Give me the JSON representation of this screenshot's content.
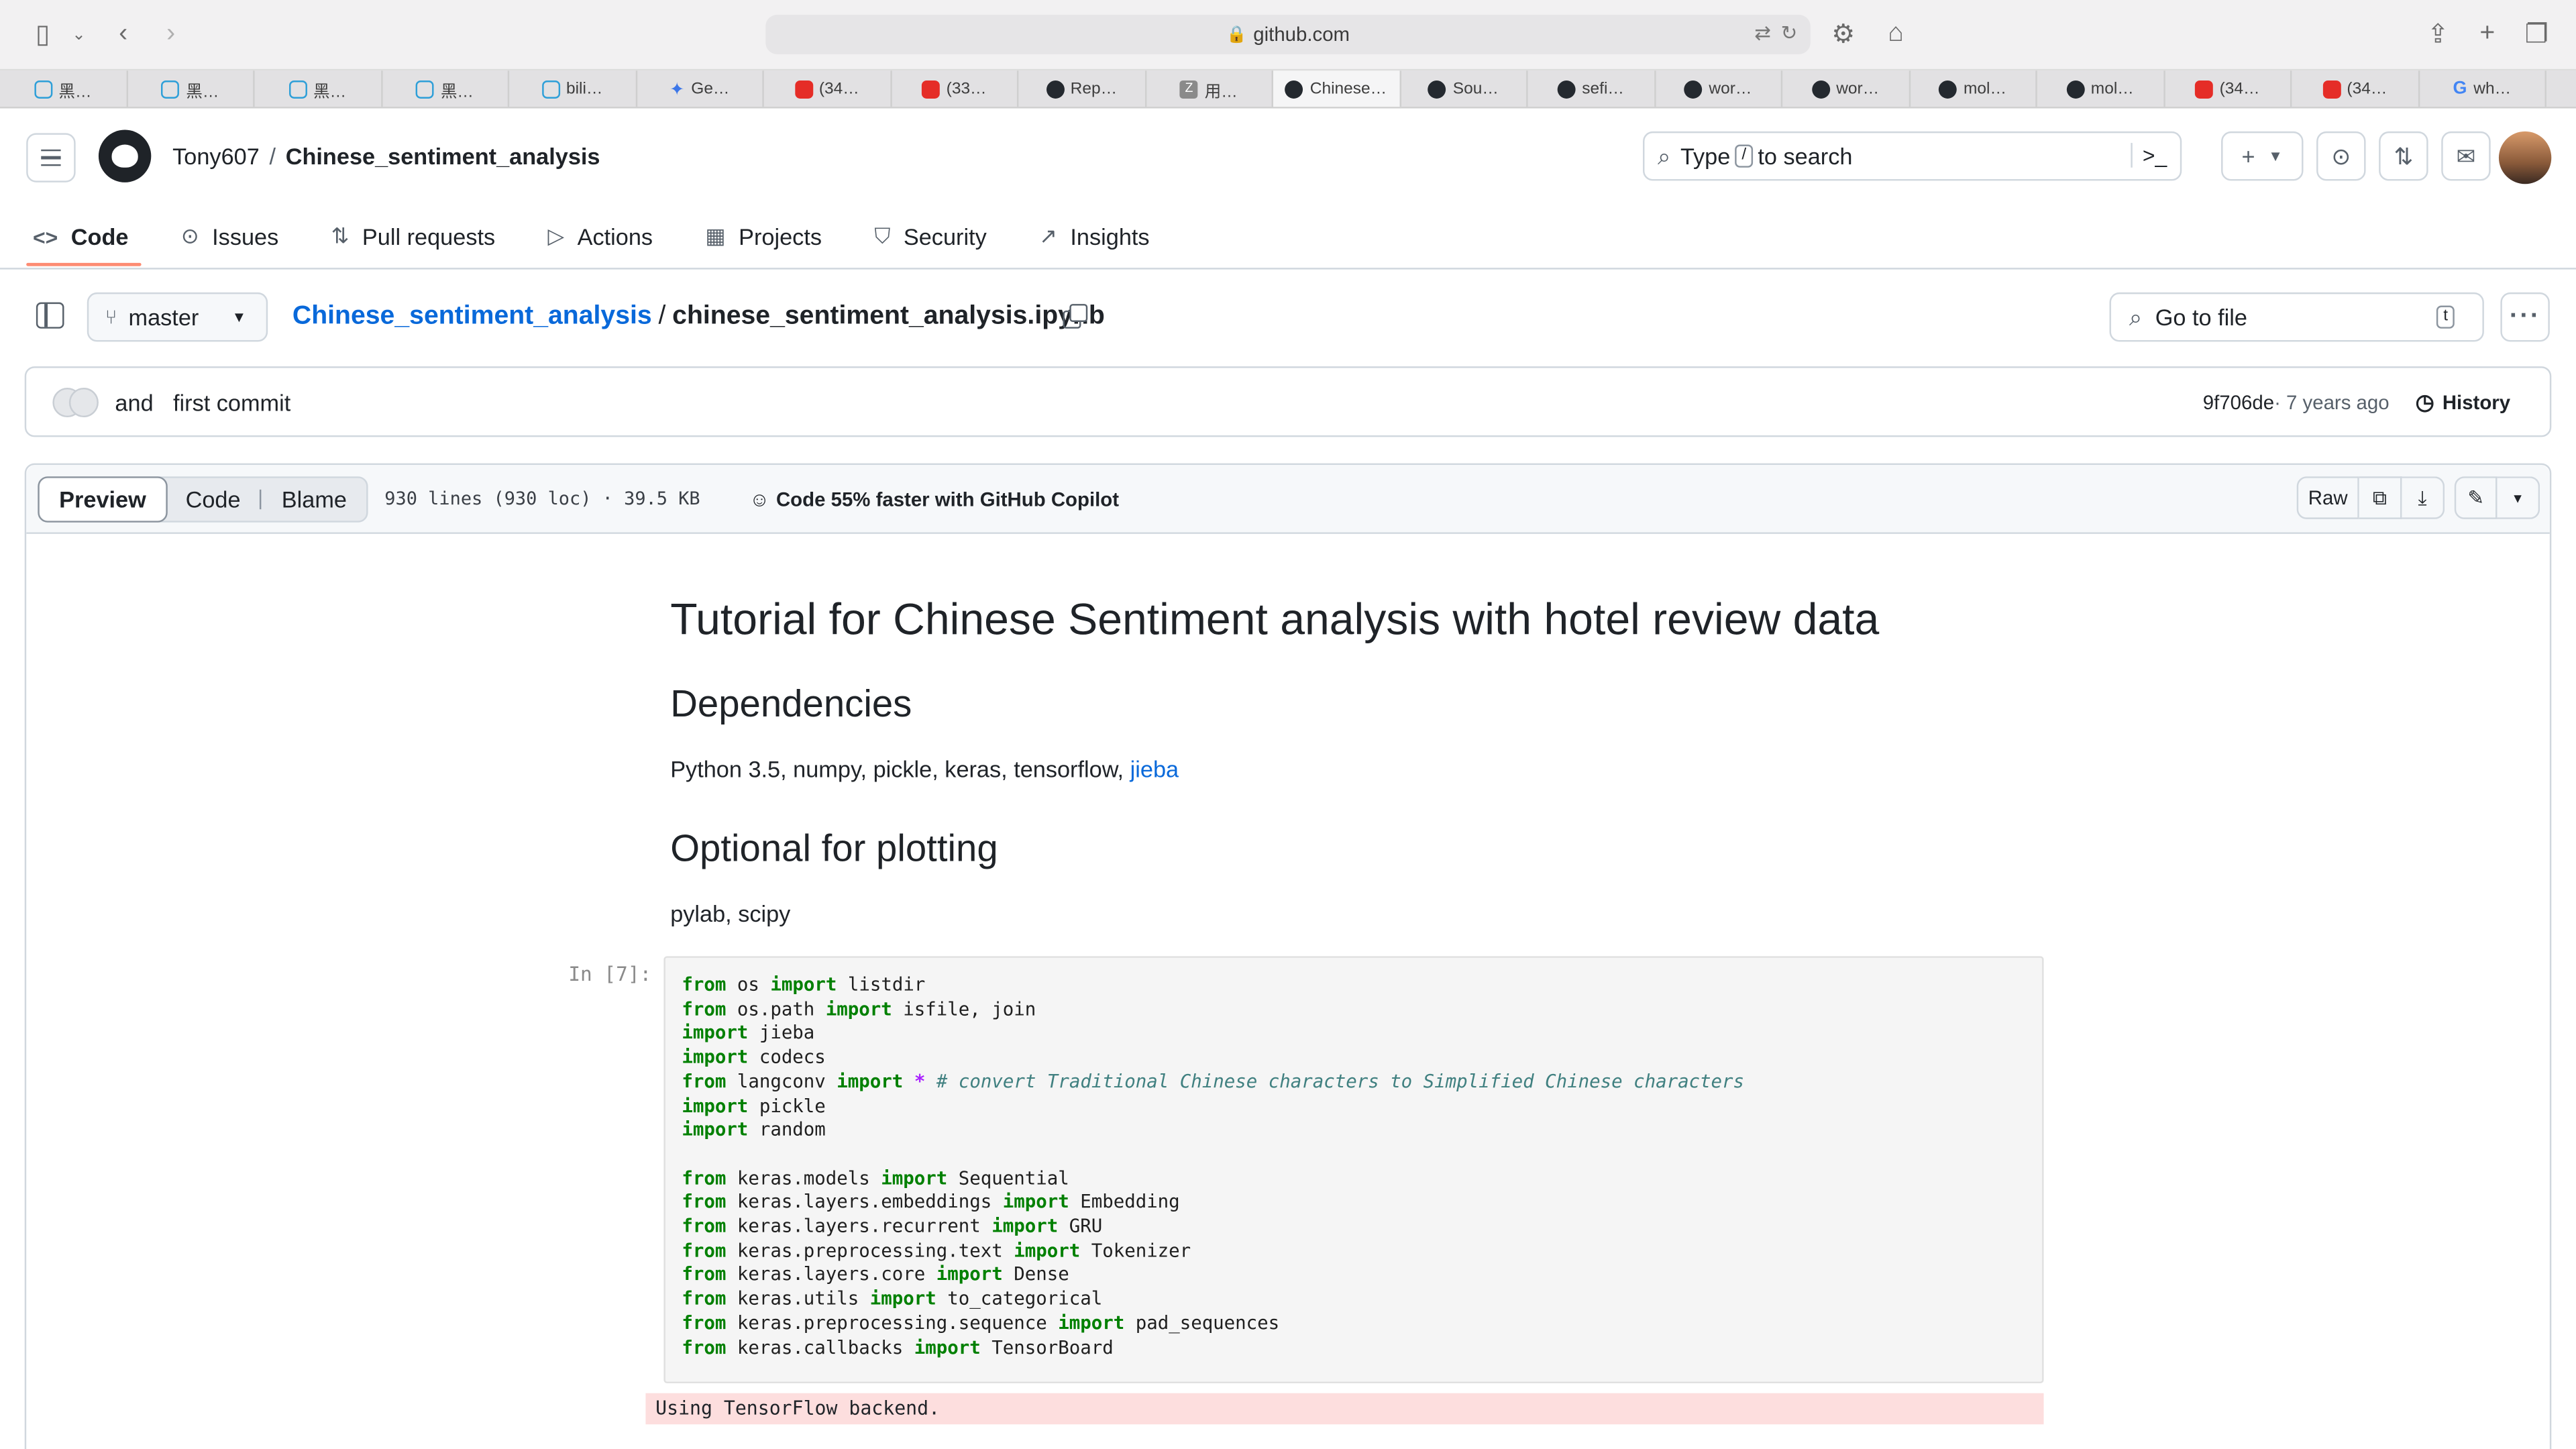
{
  "browser": {
    "url": "github.com",
    "tabs": [
      "黑…",
      "黑…",
      "黑…",
      "黑…",
      "bili…",
      "Ge…",
      "(34…",
      "(33…",
      "Rep…",
      "用…",
      "Chinese…",
      "Sou…",
      "sefi…",
      "wor…",
      "wor…",
      "mol…",
      "mol…",
      "(34…",
      "(34…",
      "wh…"
    ]
  },
  "header": {
    "owner": "Tony607",
    "separator": "/",
    "repo": "Chinese_sentiment_analysis",
    "search_prefix": "Type",
    "search_key": "/",
    "search_suffix": "to search"
  },
  "nav": [
    {
      "label": "Code",
      "icon": "<>"
    },
    {
      "label": "Issues",
      "icon": "⊙"
    },
    {
      "label": "Pull requests",
      "icon": "⇅"
    },
    {
      "label": "Actions",
      "icon": "▷"
    },
    {
      "label": "Projects",
      "icon": "▦"
    },
    {
      "label": "Security",
      "icon": "⛉"
    },
    {
      "label": "Insights",
      "icon": "↗"
    }
  ],
  "filebar": {
    "branch": "master",
    "repo_link": "Chinese_sentiment_analysis",
    "sep": "/",
    "filename": "chinese_sentiment_analysis.ipynb",
    "goto": "Go to file",
    "goto_key": "t"
  },
  "commit": {
    "author": "and",
    "message": "first commit",
    "sha": "9f706de",
    "age": " · 7 years ago",
    "history": "History"
  },
  "viewer": {
    "tabs": [
      "Preview",
      "Code",
      "Blame"
    ],
    "meta": "930 lines (930 loc) · 39.5 KB",
    "copilot": "Code 55% faster with GitHub Copilot",
    "raw": "Raw"
  },
  "notebook": {
    "title": "Tutorial for Chinese Sentiment analysis with hotel review data",
    "h_deps": "Dependencies",
    "deps_text": "Python 3.5, numpy, pickle, keras, tensorflow, ",
    "deps_link": "jieba",
    "h_plot": "Optional for plotting",
    "plot_text": "pylab, scipy",
    "prompt": "In [7]:",
    "code_lines": [
      [
        [
          "kw",
          "from"
        ],
        [
          "t",
          " os "
        ],
        [
          "kw",
          "import"
        ],
        [
          "t",
          " listdir"
        ]
      ],
      [
        [
          "kw",
          "from"
        ],
        [
          "t",
          " os.path "
        ],
        [
          "kw",
          "import"
        ],
        [
          "t",
          " isfile, join"
        ]
      ],
      [
        [
          "kw",
          "import"
        ],
        [
          "t",
          " jieba"
        ]
      ],
      [
        [
          "kw",
          "import"
        ],
        [
          "t",
          " codecs"
        ]
      ],
      [
        [
          "kw",
          "from"
        ],
        [
          "t",
          " langconv "
        ],
        [
          "kw",
          "import"
        ],
        [
          "t",
          " "
        ],
        [
          "op",
          "*"
        ],
        [
          "t",
          " "
        ],
        [
          "cm",
          "# convert Traditional Chinese characters to Simplified Chinese characters"
        ]
      ],
      [
        [
          "kw",
          "import"
        ],
        [
          "t",
          " pickle"
        ]
      ],
      [
        [
          "kw",
          "import"
        ],
        [
          "t",
          " random"
        ]
      ],
      [],
      [
        [
          "kw",
          "from"
        ],
        [
          "t",
          " keras.models "
        ],
        [
          "kw",
          "import"
        ],
        [
          "t",
          " Sequential"
        ]
      ],
      [
        [
          "kw",
          "from"
        ],
        [
          "t",
          " keras.layers.embeddings "
        ],
        [
          "kw",
          "import"
        ],
        [
          "t",
          " Embedding"
        ]
      ],
      [
        [
          "kw",
          "from"
        ],
        [
          "t",
          " keras.layers.recurrent "
        ],
        [
          "kw",
          "import"
        ],
        [
          "t",
          " GRU"
        ]
      ],
      [
        [
          "kw",
          "from"
        ],
        [
          "t",
          " keras.preprocessing.text "
        ],
        [
          "kw",
          "import"
        ],
        [
          "t",
          " Tokenizer"
        ]
      ],
      [
        [
          "kw",
          "from"
        ],
        [
          "t",
          " keras.layers.core "
        ],
        [
          "kw",
          "import"
        ],
        [
          "t",
          " Dense"
        ]
      ],
      [
        [
          "kw",
          "from"
        ],
        [
          "t",
          " keras.utils "
        ],
        [
          "kw",
          "import"
        ],
        [
          "t",
          " to_categorical"
        ]
      ],
      [
        [
          "kw",
          "from"
        ],
        [
          "t",
          " keras.preprocessing.sequence "
        ],
        [
          "kw",
          "import"
        ],
        [
          "t",
          " pad_sequences"
        ]
      ],
      [
        [
          "kw",
          "from"
        ],
        [
          "t",
          " keras.callbacks "
        ],
        [
          "kw",
          "import"
        ],
        [
          "t",
          " TensorBoard"
        ]
      ]
    ],
    "output": "Using TensorFlow backend."
  }
}
